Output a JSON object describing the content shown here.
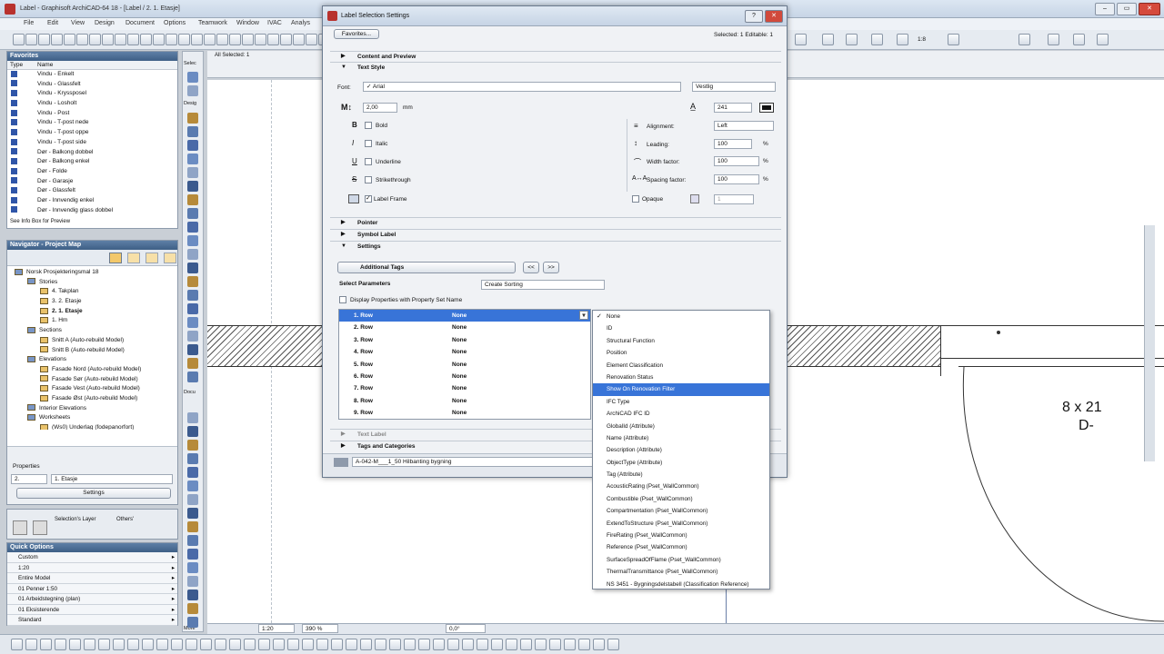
{
  "window": {
    "title": "Label - Graphisoft ArchiCAD-64 18 - [Label / 2. 1. Etasje]"
  },
  "menu": [
    "File",
    "Edit",
    "View",
    "Design",
    "Document",
    "Options",
    "Teamwork",
    "Window",
    "IVAC",
    "Analys"
  ],
  "favorites": {
    "title": "Favorites",
    "col_type": "Type",
    "col_name": "Name",
    "items": [
      "Vindu - Enkelt",
      "Vindu - Glassfelt",
      "Vindu - Kryssposel",
      "Vindu - Losholt",
      "Vindu - Post",
      "Vindu - T-post nede",
      "Vindu - T-post oppe",
      "Vindu - T-post side",
      "Dør - Balkong dobbel",
      "Dør - Balkong enkel",
      "Dør - Folde",
      "Dør - Garasje",
      "Dør - Glassfelt",
      "Dør - Innvendig enkel",
      "Dør - Innvendig glass dobbel"
    ],
    "footer": "See Info Box for Preview"
  },
  "navigator": {
    "title": "Navigator - Project Map",
    "items": [
      {
        "label": "Norsk Prosjekteringsmal 18",
        "indent": 0,
        "bold": false
      },
      {
        "label": "Stories",
        "indent": 1,
        "bold": false
      },
      {
        "label": "4. Takplan",
        "indent": 2,
        "bold": false
      },
      {
        "label": "3. 2. Etasje",
        "indent": 2,
        "bold": false
      },
      {
        "label": "2. 1. Etasje",
        "indent": 2,
        "bold": true
      },
      {
        "label": "1. Hm",
        "indent": 2,
        "bold": false
      },
      {
        "label": "Sections",
        "indent": 1,
        "bold": false
      },
      {
        "label": "Snitt A (Auto-rebuild Model)",
        "indent": 2,
        "bold": false
      },
      {
        "label": "Snitt B (Auto-rebuild Model)",
        "indent": 2,
        "bold": false
      },
      {
        "label": "Elevations",
        "indent": 1,
        "bold": false
      },
      {
        "label": "Fasade Nord (Auto-rebuild Model)",
        "indent": 2,
        "bold": false
      },
      {
        "label": "Fasade Sør (Auto-rebuild Model)",
        "indent": 2,
        "bold": false
      },
      {
        "label": "Fasade Vest (Auto-rebuild Model)",
        "indent": 2,
        "bold": false
      },
      {
        "label": "Fasade Øst (Auto-rebuild Model)",
        "indent": 2,
        "bold": false
      },
      {
        "label": "Interior Elevations",
        "indent": 1,
        "bold": false
      },
      {
        "label": "Worksheets",
        "indent": 1,
        "bold": false
      },
      {
        "label": "(Ws0) Underlag (fodepanorfort)",
        "indent": 2,
        "bold": false
      }
    ],
    "properties_label": "Properties",
    "prop_num": "2.",
    "prop_value": "1. Etasje",
    "settings_btn": "Settings"
  },
  "layers": {
    "selection_label": "Selection's Layer",
    "others_label": "Others'"
  },
  "quick_options": {
    "title": "Quick Options",
    "items": [
      "Custom",
      "1:20",
      "Entire Model",
      "01 Penner 1:50",
      "01 Arbeidstegning (plan)",
      "01 Eksisterende",
      "Standard"
    ]
  },
  "toolbox": {
    "select_label": "Selec",
    "design_label": "Desig",
    "docu_label": "Docu",
    "more_label": "More"
  },
  "infobar": {
    "all_selected": "All Selected: 1"
  },
  "dialog": {
    "title": "Label Selection Settings",
    "favorites_btn": "Favorites...",
    "selected_info": "Selected: 1 Editable: 1",
    "section_content": "Content and Preview",
    "section_text_style": "Text Style",
    "font_label": "Font:",
    "font_value": "✓ Arial",
    "encoding_value": "Vestlig",
    "size_value": "2,00",
    "size_unit": "mm",
    "pen_value": "241",
    "bold": "Bold",
    "italic": "Italic",
    "underline": "Underline",
    "strikethrough": "Strikethrough",
    "alignment_label": "Alignment:",
    "alignment_value": "Left",
    "leading_label": "Leading:",
    "leading_value": "100",
    "width_label": "Width factor:",
    "width_value": "100",
    "spacing_label": "Spacing factor:",
    "spacing_value": "100",
    "pct": "%",
    "label_frame": "Label Frame",
    "opaque": "Opaque",
    "opaque_value": "1",
    "section_pointer": "Pointer",
    "section_symbol": "Symbol Label",
    "section_settings": "Settings",
    "settings_dropdown": "Additional Tags",
    "prev_btn": "<<",
    "next_btn": ">>",
    "select_params": "Select Parameters",
    "sorting_value": "Create Sorting",
    "display_props": "Display Properties with Property Set Name",
    "rows": [
      {
        "row": "1. Row",
        "val": "None"
      },
      {
        "row": "2. Row",
        "val": "None"
      },
      {
        "row": "3. Row",
        "val": "None"
      },
      {
        "row": "4. Row",
        "val": "None"
      },
      {
        "row": "5. Row",
        "val": "None"
      },
      {
        "row": "6. Row",
        "val": "None"
      },
      {
        "row": "7. Row",
        "val": "None"
      },
      {
        "row": "8. Row",
        "val": "None"
      },
      {
        "row": "9. Row",
        "val": "None"
      }
    ],
    "section_text_label": "Text Label",
    "section_tags": "Tags and Categories",
    "layer_value": "A-042-M___1_50 Hilbanting bygning"
  },
  "dropdown": {
    "items": [
      "None",
      "ID",
      "Structural Function",
      "Position",
      "Element Classification",
      "Renovation Status",
      "Show On Renovation Filter",
      "IFC Type",
      "ArchiCAD IFC ID",
      "GlobalId (Attribute)",
      "Name (Attribute)",
      "Description (Attribute)",
      "ObjectType (Attribute)",
      "Tag (Attribute)",
      "AcousticRating (Pset_WallCommon)",
      "Combustible (Pset_WallCommon)",
      "Compartmentation (Pset_WallCommon)",
      "ExtendToStructure (Pset_WallCommon)",
      "FireRating (Pset_WallCommon)",
      "Reference (Pset_WallCommon)",
      "SurfaceSpreadOfFlame (Pset_WallCommon)",
      "ThermalTransmittance (Pset_WallCommon)",
      "NS 3451 - Bygningsdelstabell (Classification Reference)"
    ],
    "checked_index": 0,
    "selected_index": 6
  },
  "canvas": {
    "door_label_1": "8 x 21",
    "door_label_2": "D-"
  },
  "status": {
    "scale": "1:20",
    "zoom": "390 %",
    "angle": "0,0°"
  },
  "toolbar_right": {
    "mode": "1:8"
  }
}
